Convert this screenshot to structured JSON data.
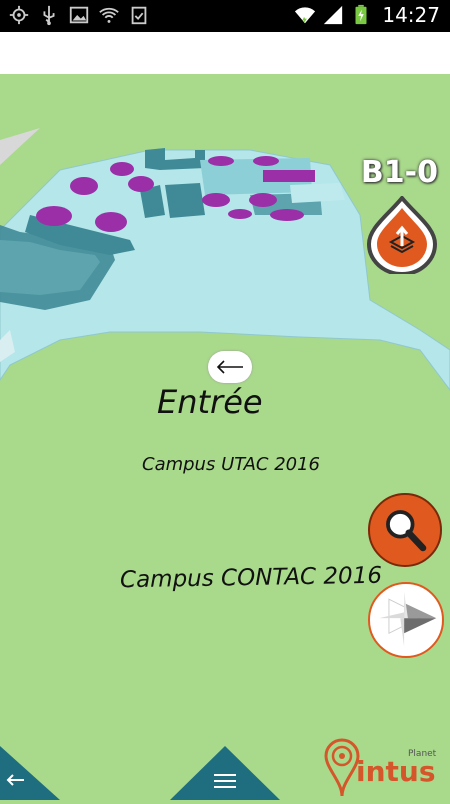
{
  "status_bar": {
    "time": "14:27",
    "left_icons": [
      "gps-icon",
      "usb-icon",
      "image-icon",
      "wifi-question-icon",
      "clipboard-check-icon"
    ],
    "right_icons": [
      "wifi-icon",
      "signal-icon",
      "battery-charging-icon"
    ]
  },
  "map": {
    "level": "B1-0",
    "labels": {
      "entrance": "Entrée",
      "campus_utac": "Campus UTAC 2016",
      "campus_contac": "Campus CONTAC 2016"
    }
  },
  "controls": {
    "level_button_icon": "floor-switch-icon",
    "back_bubble_icon": "arrow-left-icon",
    "search_icon": "magnifier-icon",
    "compass_icon": "compass-icon"
  },
  "bottom_nav": {
    "back_icon": "arrow-left-icon",
    "menu_icon": "hamburger-menu-icon"
  },
  "brand": {
    "logo_small_text": "Planet",
    "logo_text": "intus",
    "accent_color": "#e05a1f",
    "nav_color": "#1f6e80"
  }
}
